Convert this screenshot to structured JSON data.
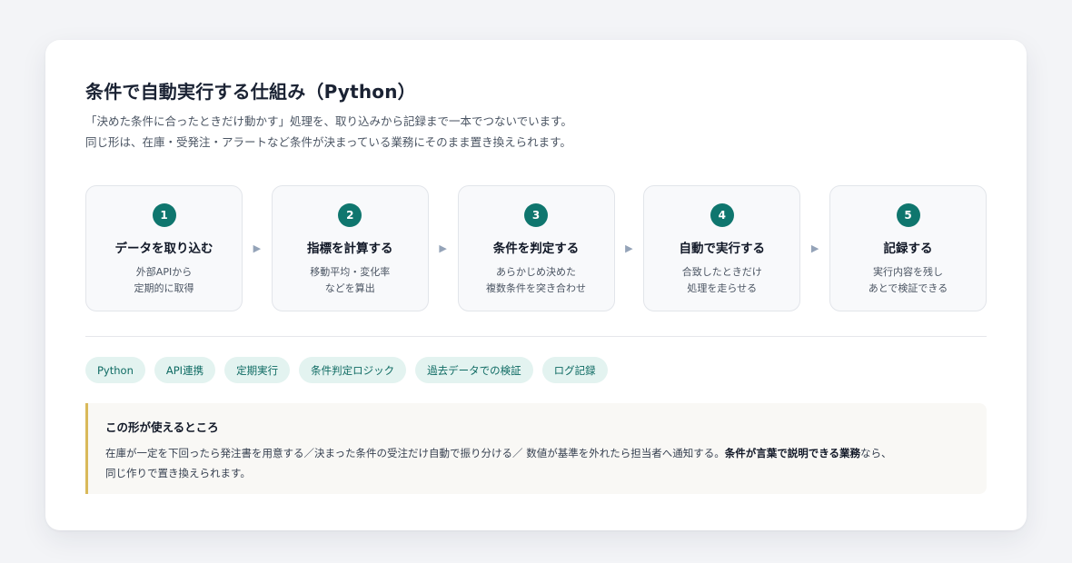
{
  "title": "条件で自動実行する仕組み（Python）",
  "subtitle": {
    "line1": "「決めた条件に合ったときだけ動かす」処理を、取り込みから記録まで一本でつないでいます。",
    "line2": "同じ形は、在庫・受発注・アラートなど条件が決まっている業務にそのまま置き換えられます。"
  },
  "steps": [
    {
      "num": "1",
      "title": "データを取り込む",
      "desc": "外部APIから\n定期的に取得"
    },
    {
      "num": "2",
      "title": "指標を計算する",
      "desc": "移動平均・変化率\nなどを算出"
    },
    {
      "num": "3",
      "title": "条件を判定する",
      "desc": "あらかじめ決めた\n複数条件を突き合わせ"
    },
    {
      "num": "4",
      "title": "自動で実行する",
      "desc": "合致したときだけ\n処理を走らせる"
    },
    {
      "num": "5",
      "title": "記録する",
      "desc": "実行内容を残し\nあとで検証できる"
    }
  ],
  "arrow_glyph": "▶",
  "tags": [
    "Python",
    "API連携",
    "定期実行",
    "条件判定ロジック",
    "過去データでの検証",
    "ログ記録"
  ],
  "note": {
    "title": "この形が使えるところ",
    "body_pre": "在庫が一定を下回ったら発注書を用意する／決まった条件の受注だけ自動で振り分ける／ 数値が基準を外れたら担当者へ通知する。",
    "body_bold": "条件が言葉で説明できる業務",
    "body_post": "なら、",
    "body_line2": "同じ作りで置き換えられます。"
  },
  "colors": {
    "accent": "#0f766e",
    "tag_bg": "#e3f3f0",
    "note_border": "#d9b95a"
  }
}
